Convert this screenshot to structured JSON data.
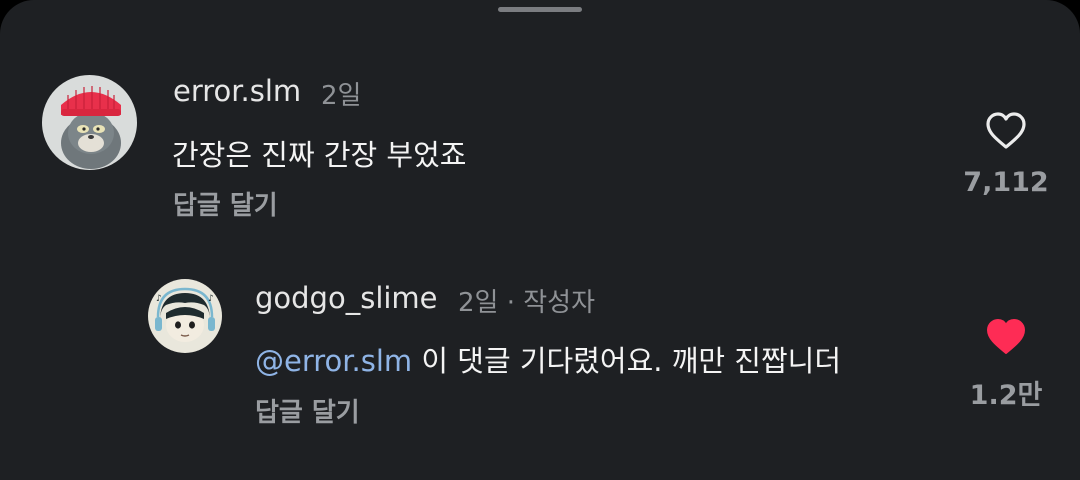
{
  "comments": [
    {
      "username": "error.slm",
      "time": "2일",
      "text": "간장은 진짜 간장 부었죠",
      "reply_label": "답글 달기",
      "like_count": "7,112",
      "liked": false,
      "like_icon": "heart-outline-icon"
    },
    {
      "username": "godgo_slime",
      "time": "2일",
      "author_badge": "작성자",
      "mention": "@error.slm",
      "text": " 이 댓글 기다렸어요. 깨만 진짭니더",
      "reply_label": "답글 달기",
      "like_count": "1.2만",
      "liked": true,
      "like_icon": "heart-filled-icon",
      "like_color": "#fe2c55"
    }
  ]
}
